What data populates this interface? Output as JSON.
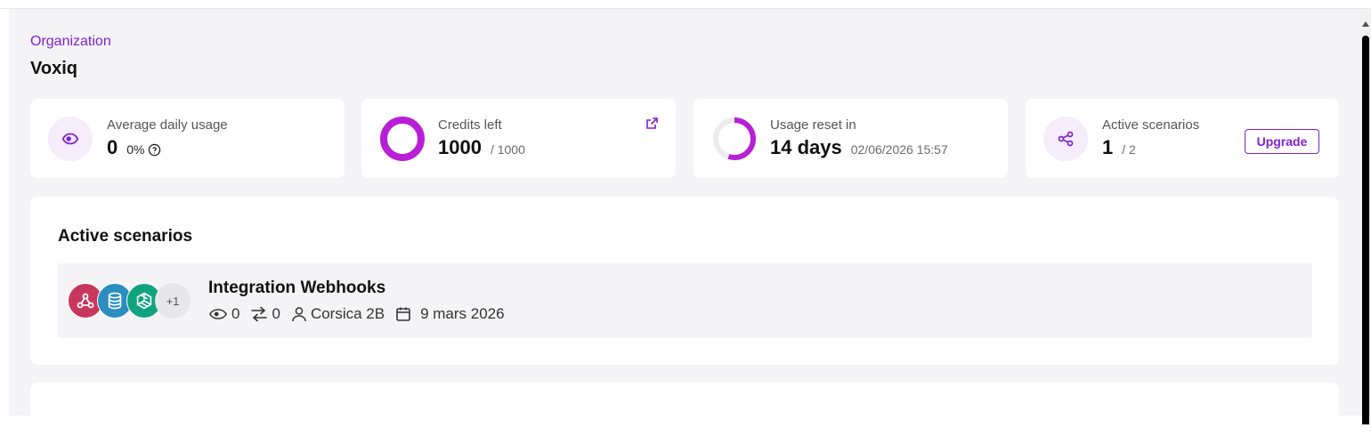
{
  "organization": {
    "label": "Organization",
    "name": "Voxiq"
  },
  "stats": {
    "daily_usage": {
      "label": "Average daily usage",
      "value": "0",
      "percent": "0%",
      "icon": "eye-icon"
    },
    "credits": {
      "label": "Credits left",
      "value": "1000",
      "total": "/ 1000",
      "fraction_remaining": 1.0
    },
    "reset": {
      "label": "Usage reset in",
      "value": "14 days",
      "date": "02/06/2026 15:57",
      "fraction_elapsed": 0.55
    },
    "scenarios": {
      "label": "Active scenarios",
      "value": "1",
      "total": "/ 2",
      "upgrade_label": "Upgrade",
      "icon": "share-nodes-icon"
    }
  },
  "active_scenarios": {
    "title": "Active scenarios",
    "items": [
      {
        "name": "Integration Webhooks",
        "apps": [
          "webhook-icon",
          "database-icon",
          "openai-icon"
        ],
        "more": "+1",
        "views": "0",
        "transfers": "0",
        "owner": "Corsica 2B",
        "date": "9 mars 2026"
      }
    ]
  },
  "colors": {
    "accent": "#7e22ce",
    "accent_light": "#f5ecfc",
    "webhook": "#c8375d",
    "database": "#2b8dc0",
    "openai": "#10a37f"
  }
}
